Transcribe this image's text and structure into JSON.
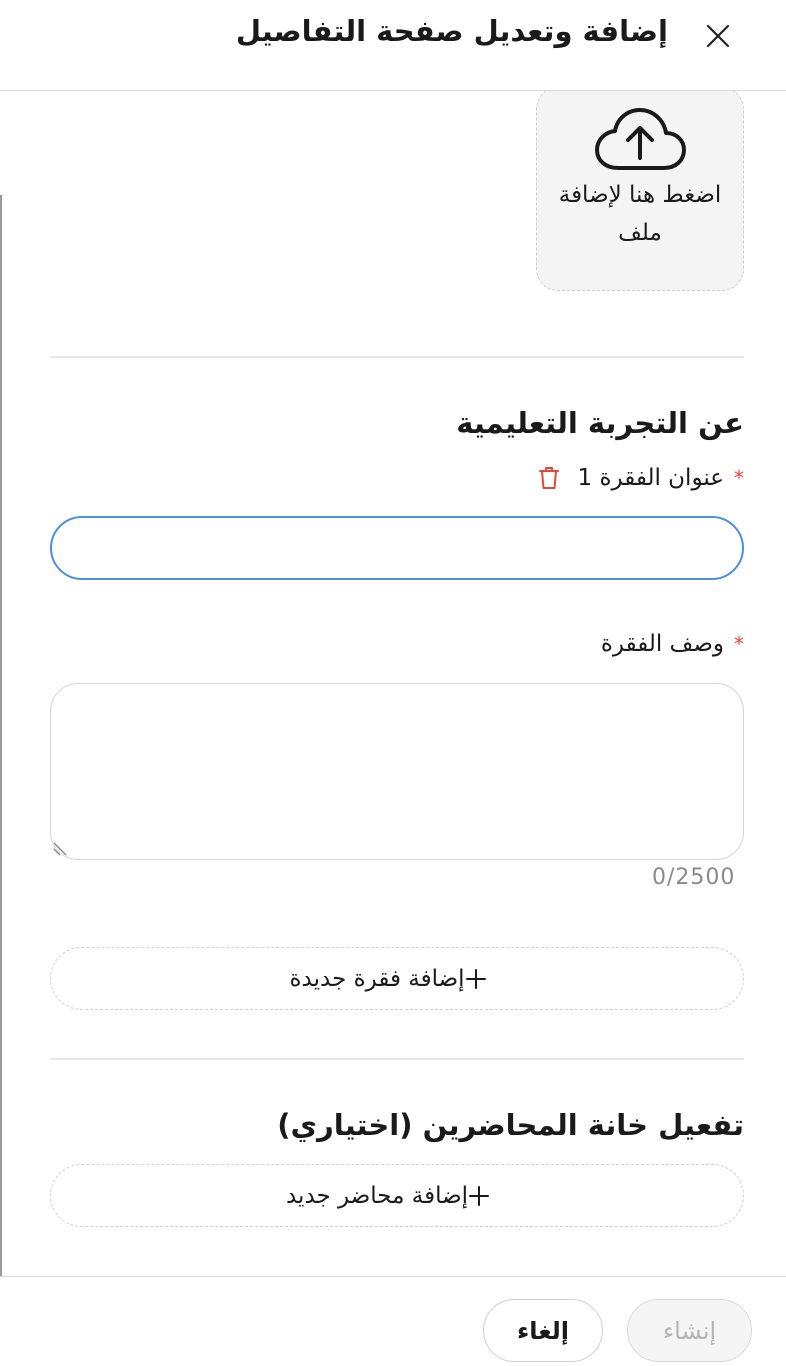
{
  "header": {
    "title": "إضافة وتعديل صفحة التفاصيل",
    "close_icon": "close-icon"
  },
  "upload": {
    "icon": "cloud-upload-icon",
    "text": "اضغط هنا لإضافة ملف"
  },
  "about_section": {
    "title": "عن التجربة التعليمية",
    "paragraph_title_label": "عنوان الفقرة 1",
    "required_mark": "*",
    "delete_icon": "trash-icon",
    "paragraph_title_value": "",
    "paragraph_desc_label": "وصف الفقرة",
    "paragraph_desc_value": "",
    "char_counter": "0/2500",
    "add_paragraph_label": "إضافة فقرة جديدة"
  },
  "lecturers_section": {
    "title": "تفعيل خانة المحاضرين (اختياري)",
    "add_lecturer_label": "إضافة محاضر جديد"
  },
  "footer": {
    "create_label": "إنشاء",
    "cancel_label": "إلغاء"
  },
  "colors": {
    "accent": "#4a8fe0",
    "required": "#e8463a",
    "delete": "#e8463a",
    "disabled_text": "#b5b5b5"
  }
}
